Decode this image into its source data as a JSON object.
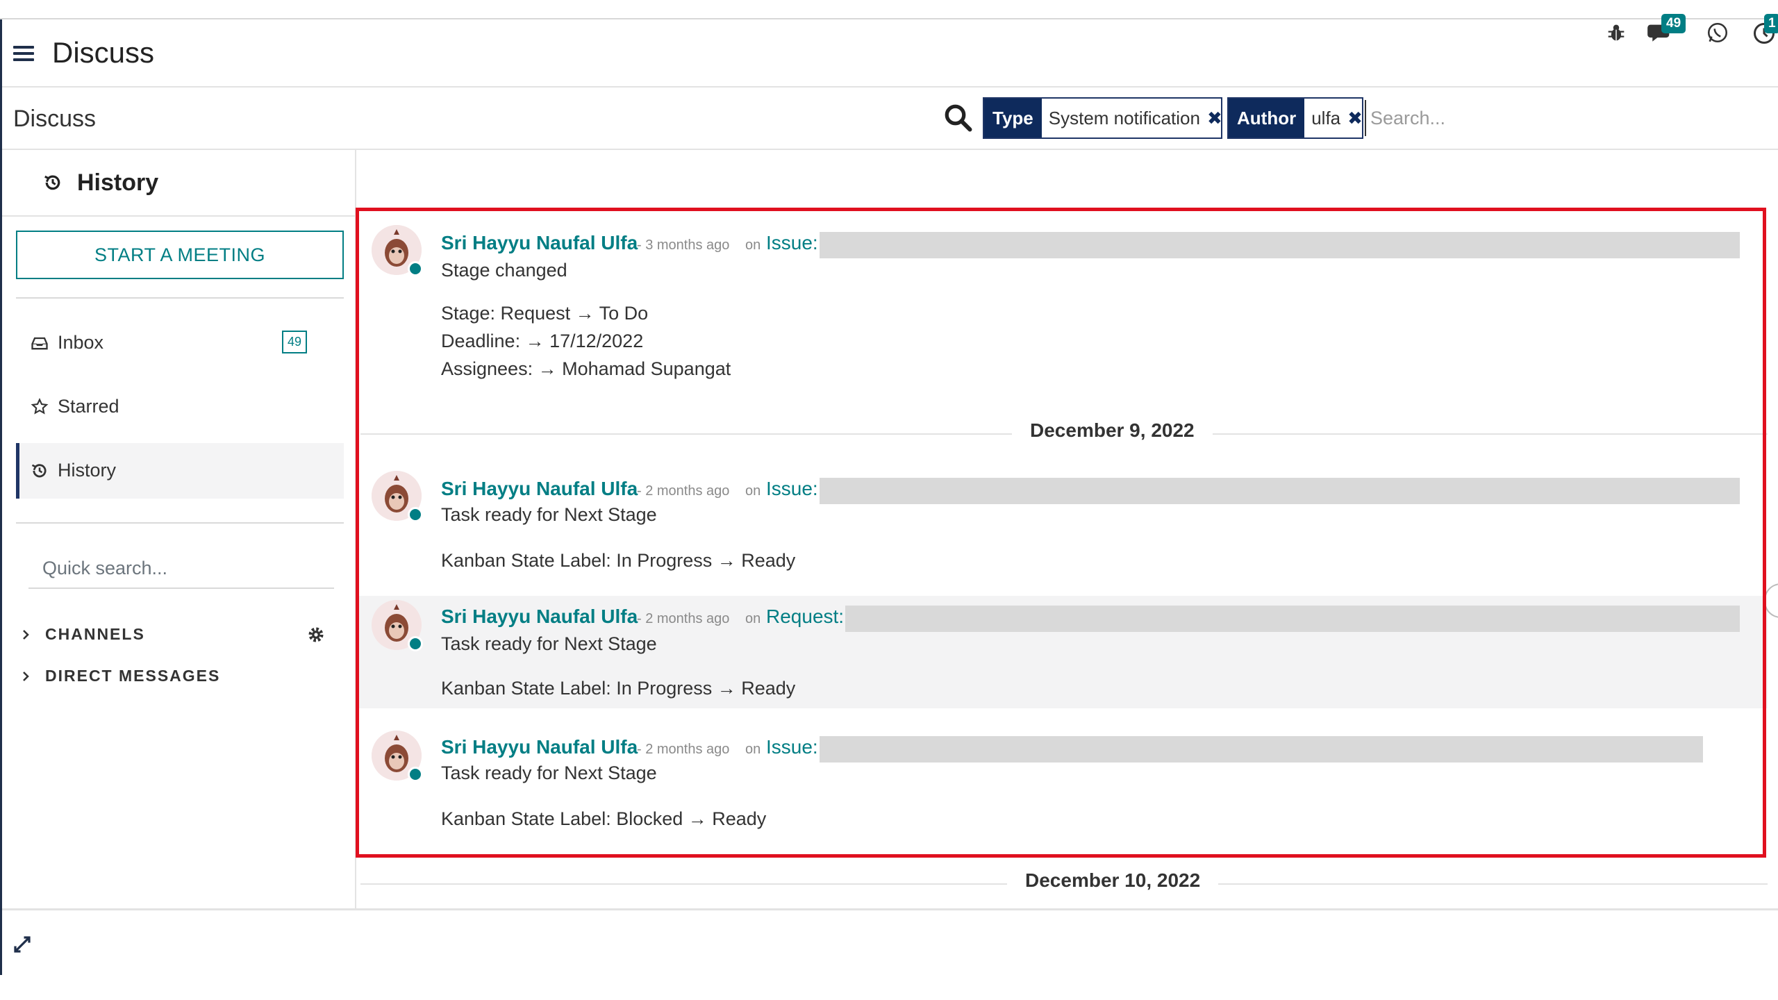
{
  "app": {
    "title": "Discuss"
  },
  "systray": {
    "chat_count": "49",
    "activity_count": "1"
  },
  "control": {
    "breadcrumb": "Discuss",
    "facets": [
      {
        "label": "Type",
        "value": "System notification"
      },
      {
        "label": "Author",
        "value": "ulfa"
      }
    ],
    "search_placeholder": "Search..."
  },
  "sidebar": {
    "header": "History",
    "start_meeting": "START A MEETING",
    "items": [
      {
        "label": "Inbox",
        "badge": "49"
      },
      {
        "label": "Starred"
      },
      {
        "label": "History"
      }
    ],
    "quick_search_placeholder": "Quick search...",
    "categories": [
      "CHANNELS",
      "DIRECT MESSAGES"
    ]
  },
  "thread": {
    "messages": [
      {
        "author": "Sri Hayyu Naufal Ulfa",
        "time": "- 3 months ago",
        "on": "on",
        "record": "Issue:",
        "subject": "Stage changed",
        "tracking": [
          "Stage: Request → To Do",
          "Deadline: → 17/12/2022",
          "Assignees: → Mohamad Supangat"
        ]
      },
      {
        "author": "Sri Hayyu Naufal Ulfa",
        "time": "- 2 months ago",
        "on": "on",
        "record": "Issue:",
        "subject": "Task ready for Next Stage",
        "tracking": [
          "Kanban State Label: In Progress → Ready"
        ]
      },
      {
        "author": "Sri Hayyu Naufal Ulfa",
        "time": "- 2 months ago",
        "on": "on",
        "record": "Request:",
        "subject": "Task ready for Next Stage",
        "tracking": [
          "Kanban State Label: In Progress → Ready"
        ]
      },
      {
        "author": "Sri Hayyu Naufal Ulfa",
        "time": "- 2 months ago",
        "on": "on",
        "record": "Issue:",
        "subject": "Task ready for Next Stage",
        "tracking": [
          "Kanban State Label: Blocked → Ready"
        ]
      }
    ],
    "date_separators": [
      "December 9, 2022",
      "December 10, 2022"
    ]
  },
  "colors": {
    "accent": "#017e84",
    "navy": "#0e2a5c",
    "highlight": "#e0101f"
  }
}
